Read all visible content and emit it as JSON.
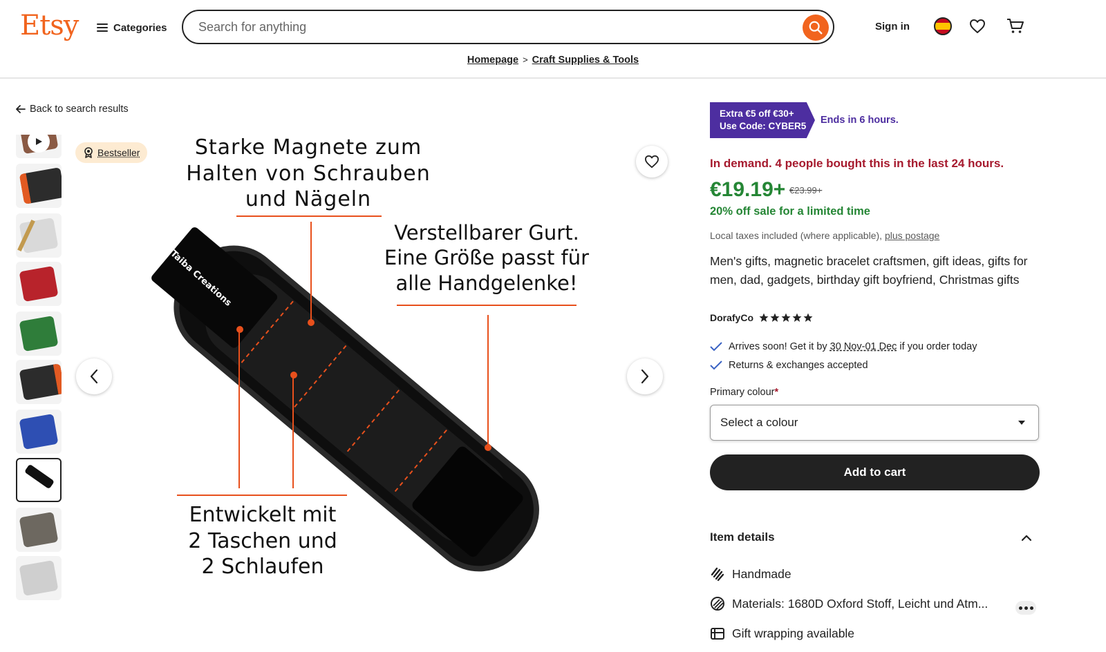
{
  "header": {
    "logo": "Etsy",
    "categories_label": "Categories",
    "search_placeholder": "Search for anything",
    "signin_label": "Sign in"
  },
  "breadcrumb": {
    "items": [
      "Homepage",
      "Craft Supplies & Tools"
    ],
    "separator": ">"
  },
  "gallery": {
    "back_label": "Back to search results",
    "badge_label": "Bestseller",
    "thumbnail_count": 10,
    "selected_thumbnail": 8,
    "image_captions": {
      "caption_1": [
        "Starke Magnete zum",
        "Halten von Schrauben",
        "und Nägeln"
      ],
      "caption_2": [
        "Verstellbarer Gurt.",
        "Eine Größe passt für",
        "alle Handgelenke!"
      ],
      "caption_3": [
        "Entwickelt mit",
        "2 Taschen und",
        "2 Schlaufen"
      ],
      "brand_on_strap": "Taiba Creations"
    }
  },
  "listing": {
    "promo_line1": "Extra €5 off €30+",
    "promo_line2": "Use Code: CYBER5",
    "promo_ends": "Ends in 6 hours.",
    "demand": "In demand. 4 people bought this in the last 24 hours.",
    "price": "€19.19+",
    "old_price": "€23.99+",
    "sale_text": "20% off sale for a limited time",
    "taxes_text": "Local taxes included (where applicable),",
    "postage_link": "plus postage",
    "title": "Men's gifts, magnetic bracelet craftsmen, gift ideas, gifts for men, dad, gadgets, birthday gift boyfriend, Christmas gifts",
    "shop_name": "DorafyCo",
    "rating_stars": 5,
    "arrival_prefix": "Arrives soon! Get it by",
    "arrival_dates": "30 Nov-01 Dec",
    "arrival_suffix": "if you order today",
    "returns": "Returns & exchanges accepted",
    "colour_label": "Primary colour",
    "colour_required": "*",
    "colour_selected": "Select a colour",
    "add_to_cart": "Add to cart",
    "item_details_heading": "Item details",
    "details": [
      {
        "icon": "handmade-icon",
        "text": "Handmade"
      },
      {
        "icon": "materials-icon",
        "text": "Materials: 1680D Oxford Stoff, Leicht und Atm..."
      },
      {
        "icon": "gift-wrap-icon",
        "text": "Gift wrapping available"
      }
    ]
  },
  "colors": {
    "brand": "#F1641E",
    "promo": "#4D2EA0",
    "demand": "#A61A2E",
    "price": "#258635",
    "badge_bg": "#FDEBD2",
    "caption_line": "#E8501C"
  }
}
